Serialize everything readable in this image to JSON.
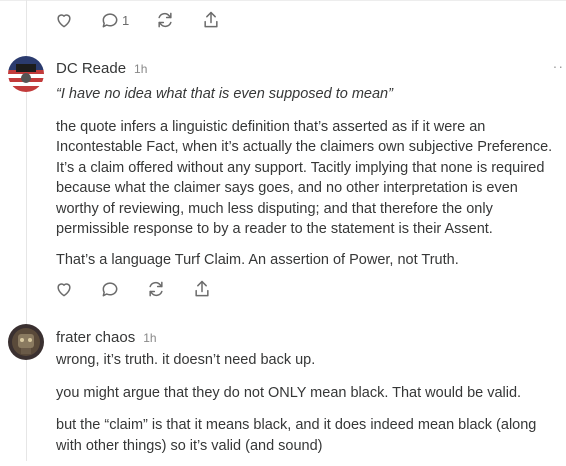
{
  "top_actions": {
    "comment_count": "1"
  },
  "comments": [
    {
      "author": "DC Reade",
      "time": "1h",
      "quote": "“I have no idea what that is even supposed to mean”",
      "paragraphs": [
        "the quote infers a linguistic definition that’s asserted as if it were an Incontestable Fact, when it’s actually the claimers own subjective Preference. It’s a claim offered without any support. Tacitly implying that none is required because what the claimer says goes, and no other interpretation is even worthy of reviewing, much less disputing; and that therefore the only permissible response to by a reader to the statement is their Assent.",
        "That’s a language Turf Claim. An assertion of Power, not Truth."
      ],
      "avatar_icon": "flag-badge-icon"
    },
    {
      "author": "frater chaos",
      "time": "1h",
      "paragraphs": [
        "wrong, it’s truth. it doesn’t need back up.",
        "you might argue that they do not ONLY mean black. That would be valid.",
        "but the “claim” is that it means black, and it does indeed mean black (along with other things) so it’s valid (and sound)"
      ],
      "avatar_icon": "robot-avatar-icon"
    }
  ],
  "more_label": "··",
  "icons": [
    "heart-icon",
    "comment-icon",
    "restack-icon",
    "share-icon",
    "more-icon"
  ],
  "colors": {
    "text": "#363737",
    "muted": "#6b6b6b",
    "divider": "#e6e6e6"
  }
}
